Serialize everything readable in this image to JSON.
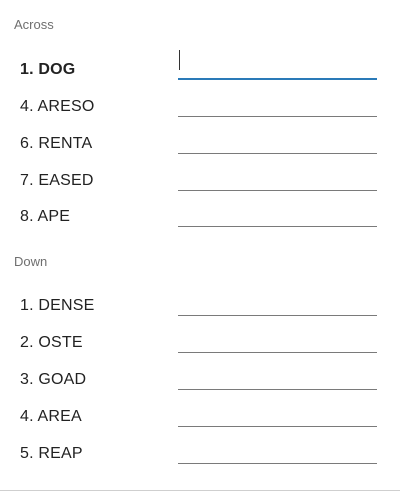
{
  "across": {
    "title": "Across",
    "clues": [
      {
        "label": "1. DOG",
        "value": "",
        "active": true
      },
      {
        "label": "4. ARESO",
        "value": ""
      },
      {
        "label": "6. RENTA",
        "value": ""
      },
      {
        "label": "7. EASED",
        "value": ""
      },
      {
        "label": "8. APE",
        "value": ""
      }
    ]
  },
  "down": {
    "title": "Down",
    "clues": [
      {
        "label": "1. DENSE",
        "value": ""
      },
      {
        "label": "2. OSTE",
        "value": ""
      },
      {
        "label": "3. GOAD",
        "value": ""
      },
      {
        "label": "4. AREA",
        "value": ""
      },
      {
        "label": "5. REAP",
        "value": ""
      }
    ]
  },
  "colors": {
    "active_underline": "#2a7ab8",
    "underline": "#7a7a7a",
    "section_title": "#6f6f6f"
  }
}
